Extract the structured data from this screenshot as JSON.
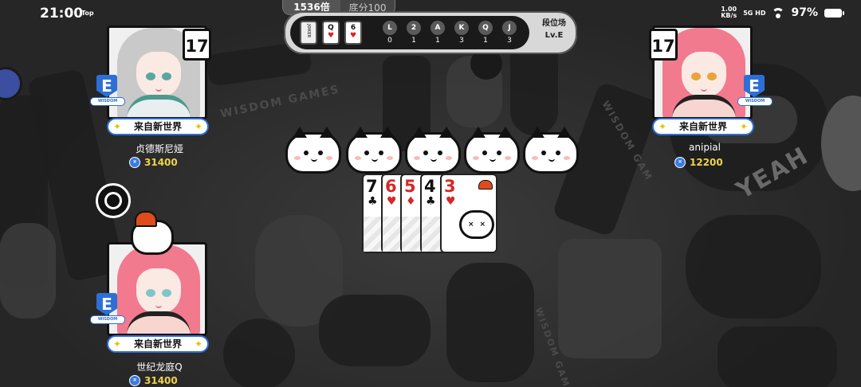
{
  "status": {
    "time": "21:00",
    "tag": "Top",
    "net_speed": "1.00",
    "net_unit": "KB/s",
    "signal": "5G HD",
    "battery": "97%"
  },
  "hud": {
    "multiplier": "1536倍",
    "base_score": "底分100",
    "recent_cards": [
      {
        "rank": "JOKER",
        "suit": ""
      },
      {
        "rank": "Q",
        "suit": "♥"
      },
      {
        "rank": "6",
        "suit": "♥"
      }
    ],
    "card_counter": [
      {
        "rank": "L",
        "count": "0"
      },
      {
        "rank": "2",
        "count": "1"
      },
      {
        "rank": "A",
        "count": "1"
      },
      {
        "rank": "K",
        "count": "3"
      },
      {
        "rank": "Q",
        "count": "1"
      },
      {
        "rank": "J",
        "count": "3"
      }
    ],
    "mode": "段位场",
    "level": "Lv.E"
  },
  "players": {
    "left_top": {
      "cards_left": "17",
      "rank": "E",
      "rank_label": "WISDOM",
      "title": "来自新世界",
      "name": "贞德斯尼娅",
      "coins": "31400"
    },
    "right_top": {
      "cards_left": "17",
      "rank": "E",
      "rank_label": "WISDOM",
      "title": "来自新世界",
      "name": "anipial",
      "coins": "12200"
    },
    "self": {
      "rank": "E",
      "rank_label": "WISDOM",
      "title": "来自新世界",
      "name": "世纪龙庭Q",
      "coins": "31400"
    }
  },
  "played_cards": [
    {
      "rank": "7",
      "suit": "♣",
      "color": "black"
    },
    {
      "rank": "6",
      "suit": "♥",
      "color": "red"
    },
    {
      "rank": "5",
      "suit": "♦",
      "color": "red"
    },
    {
      "rank": "4",
      "suit": "♣",
      "color": "black"
    },
    {
      "rank": "3",
      "suit": "♥",
      "color": "red"
    }
  ],
  "background_text": [
    "WISDOM GAMES",
    "WISDOM GAM",
    "YEAH",
    "WISDOM GAM"
  ]
}
